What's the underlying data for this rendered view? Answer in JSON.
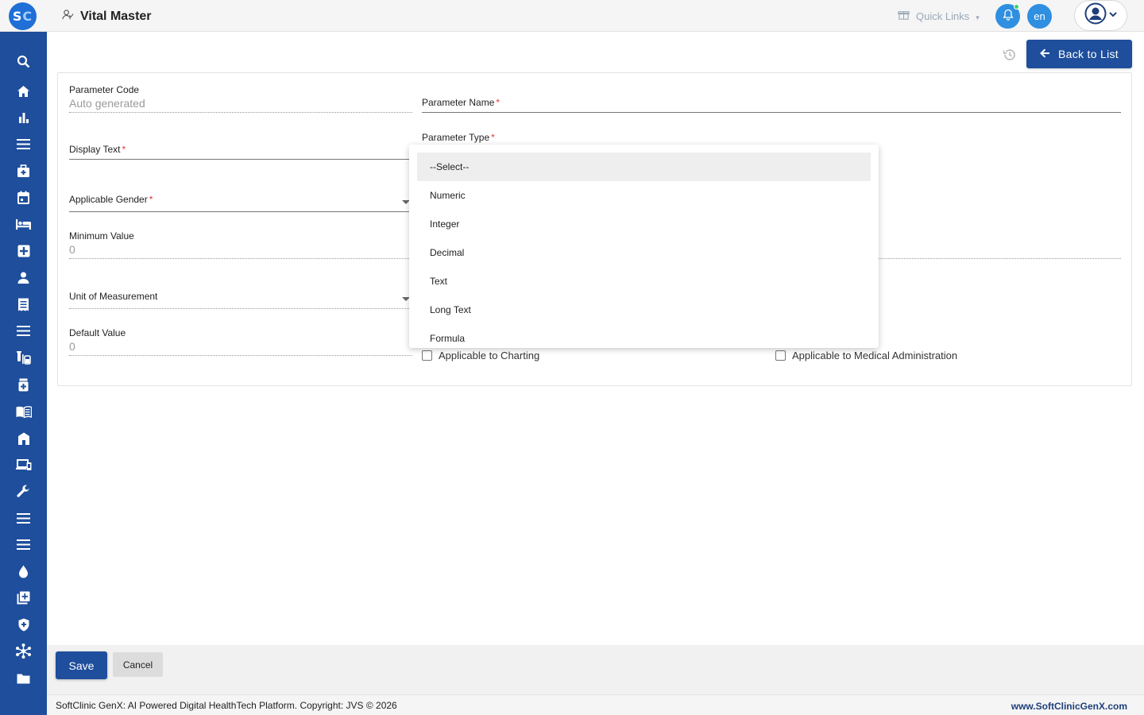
{
  "header": {
    "logo_text_s": "S",
    "logo_text_c": "C",
    "page_title": "Vital Master",
    "quick_links_label": "Quick Links",
    "language_label": "en"
  },
  "sidebar": {
    "icons": [
      "search-icon",
      "home-icon",
      "bar-chart-icon",
      "menu-icon",
      "medical-bag-icon",
      "calendar-icon",
      "bed-icon",
      "first-aid-icon",
      "person-icon",
      "receipt-icon",
      "menu-icon",
      "lab-tubes-icon",
      "pharmacy-icon",
      "book-icon",
      "building-icon",
      "devices-icon",
      "wrench-icon",
      "menu-icon",
      "menu-icon",
      "drop-icon",
      "add-library-icon",
      "shield-icon",
      "network-icon",
      "folder-icon"
    ]
  },
  "toolbar": {
    "back_label": "Back to List"
  },
  "form": {
    "parameter_code_label": "Parameter Code",
    "parameter_code_value": "Auto generated",
    "parameter_name_label": "Parameter Name",
    "display_text_label": "Display Text",
    "parameter_type_label": "Parameter Type",
    "applicable_gender_label": "Applicable Gender",
    "minimum_value_label": "Minimum Value",
    "minimum_value_value": "0",
    "unit_label": "Unit of Measurement",
    "default_value_label": "Default Value",
    "default_value_value": "0",
    "required_mark": "*",
    "charting_label": "Applicable to Charting",
    "med_admin_label": "Applicable to Medical Administration"
  },
  "parameter_type_options": {
    "o0": "--Select--",
    "o1": "Numeric",
    "o2": "Integer",
    "o3": "Decimal",
    "o4": "Text",
    "o5": "Long Text",
    "o6": "Formula"
  },
  "actions": {
    "save_label": "Save",
    "cancel_label": "Cancel"
  },
  "footer": {
    "copyright": "SoftClinic GenX: AI Powered Digital HealthTech Platform. Copyright: JVS © 2026",
    "website": "www.SoftClinicGenX.com"
  },
  "colors": {
    "brand": "#1e4e9c",
    "accent": "#2f8fe0",
    "required": "#e53935"
  }
}
